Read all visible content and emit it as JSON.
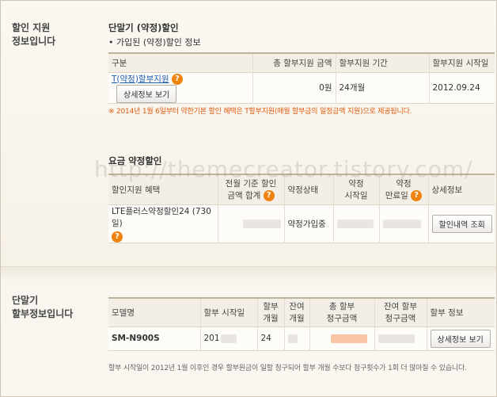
{
  "section1": {
    "side_title_line1": "할인 지원",
    "side_title_line2": "정보입니다",
    "title": "단말기 (약정)할인",
    "bullet": "• 가입된 (약정)할인 정보",
    "table": {
      "headers": [
        "구분",
        "총 할부지원 금액",
        "할부지원 기간",
        "할부지원 시작일"
      ],
      "row": {
        "type_link": "T(약정)할부지원",
        "detail_button": "상세정보 보기",
        "amount": "0원",
        "period": "24개월",
        "start_date": "2012.09.24"
      }
    },
    "note": "※ 2014년 1월 6일부터 약한기본 할인 혜택은 T할부지원(매월 할부금의 일정금액 지원)으로 제공됩니다."
  },
  "fee": {
    "title": "요금 약정할인",
    "headers": {
      "benefit": "할인지원 혜택",
      "base_line1": "전월 기준 할인",
      "base_line2": "금액 합계",
      "status": "약정상태",
      "start_line1": "약정",
      "start_line2": "시작일",
      "end_line1": "약정",
      "end_line2": "만료일",
      "detail": "상세정보"
    },
    "row": {
      "benefit": "LTE플러스약정할인24 (730 일)",
      "status": "약정가입중",
      "detail_button": "할인내역 조회"
    }
  },
  "section2": {
    "side_title_line1": "단말기",
    "side_title_line2": "할부정보입니다",
    "headers": {
      "model": "모델명",
      "start": "할부 시작일",
      "months_line1": "할부",
      "months_line2": "개월",
      "remain_line1": "잔여",
      "remain_line2": "개월",
      "total_line1": "총 할부",
      "total_line2": "청구금액",
      "remain_amt_line1": "잔여 할부",
      "remain_amt_line2": "청구금액",
      "info": "할부 정보"
    },
    "row": {
      "model": "SM-N900S",
      "start": "201",
      "months": "24",
      "detail_button": "상세정보 보기"
    },
    "note": "할부 시작일이 2012년 1월 이후인 경우 할부원금이 일할 청구되어 할부 개월 수보다 청구횟수가 1회 더 많아질 수 있습니다."
  },
  "watermark": "http://themecreator.tistory.com/",
  "colors": {
    "accent": "#f0820f",
    "link": "#1f5eb5",
    "note": "#e05a10",
    "blur_orange": "#f9c3a6",
    "blur_gray": "#e9e6e1"
  }
}
